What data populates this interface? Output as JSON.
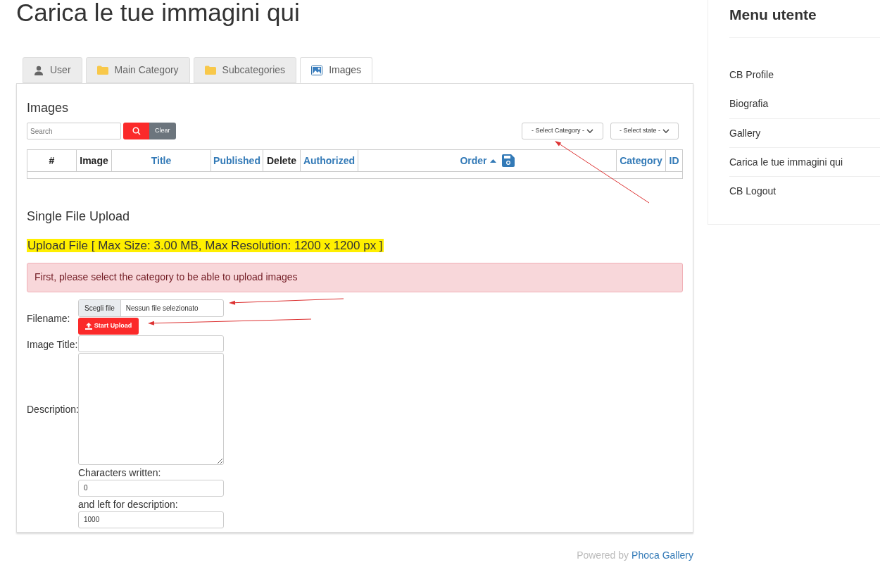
{
  "page_title": "Carica le tue immagini qui",
  "tabs": [
    {
      "label": "User",
      "kind": "user",
      "selected": false
    },
    {
      "label": "Main Category",
      "kind": "folder",
      "selected": false
    },
    {
      "label": "Subcategories",
      "kind": "folder",
      "selected": false
    },
    {
      "label": "Images",
      "kind": "image",
      "selected": true
    }
  ],
  "images_panel": {
    "heading": "Images",
    "search": {
      "placeholder": "Search"
    },
    "clear_button": "Clear",
    "category_select": "- Select Category -",
    "state_select": "- Select state -",
    "table": {
      "columns": [
        {
          "label": "#",
          "link": false
        },
        {
          "label": "Image",
          "link": false
        },
        {
          "label": "Title",
          "link": true
        },
        {
          "label": "Published",
          "link": true
        },
        {
          "label": "Delete",
          "link": false
        },
        {
          "label": "Authorized",
          "link": true
        },
        {
          "label": "Order",
          "link": true,
          "kind": "order"
        },
        {
          "label": "Category",
          "link": true
        },
        {
          "label": "ID",
          "link": true
        }
      ]
    }
  },
  "upload": {
    "heading": "Single File Upload",
    "limits": "Upload File [ Max Size: 3.00 MB, Max Resolution: 1200 x 1200 px ]",
    "alert": "First, please select the category to be able to upload images",
    "filename_label": "Filename:",
    "choose_button": "Scegli file",
    "no_file": "Nessun file selezionato",
    "start_button": "Start Upload",
    "image_title_label": "Image Title:",
    "description_label": "Description:",
    "chars_written_label": "Characters written:",
    "chars_written": "0",
    "chars_left_label": "and left for description:",
    "chars_left": "1000"
  },
  "footer": {
    "prefix": "Powered by",
    "link": "Phoca Gallery"
  },
  "sidebar": {
    "title": "Menu utente",
    "items": [
      "CB Profile",
      "Biografia",
      "Gallery",
      "Carica le tue immagini qui",
      "CB Logout"
    ]
  }
}
